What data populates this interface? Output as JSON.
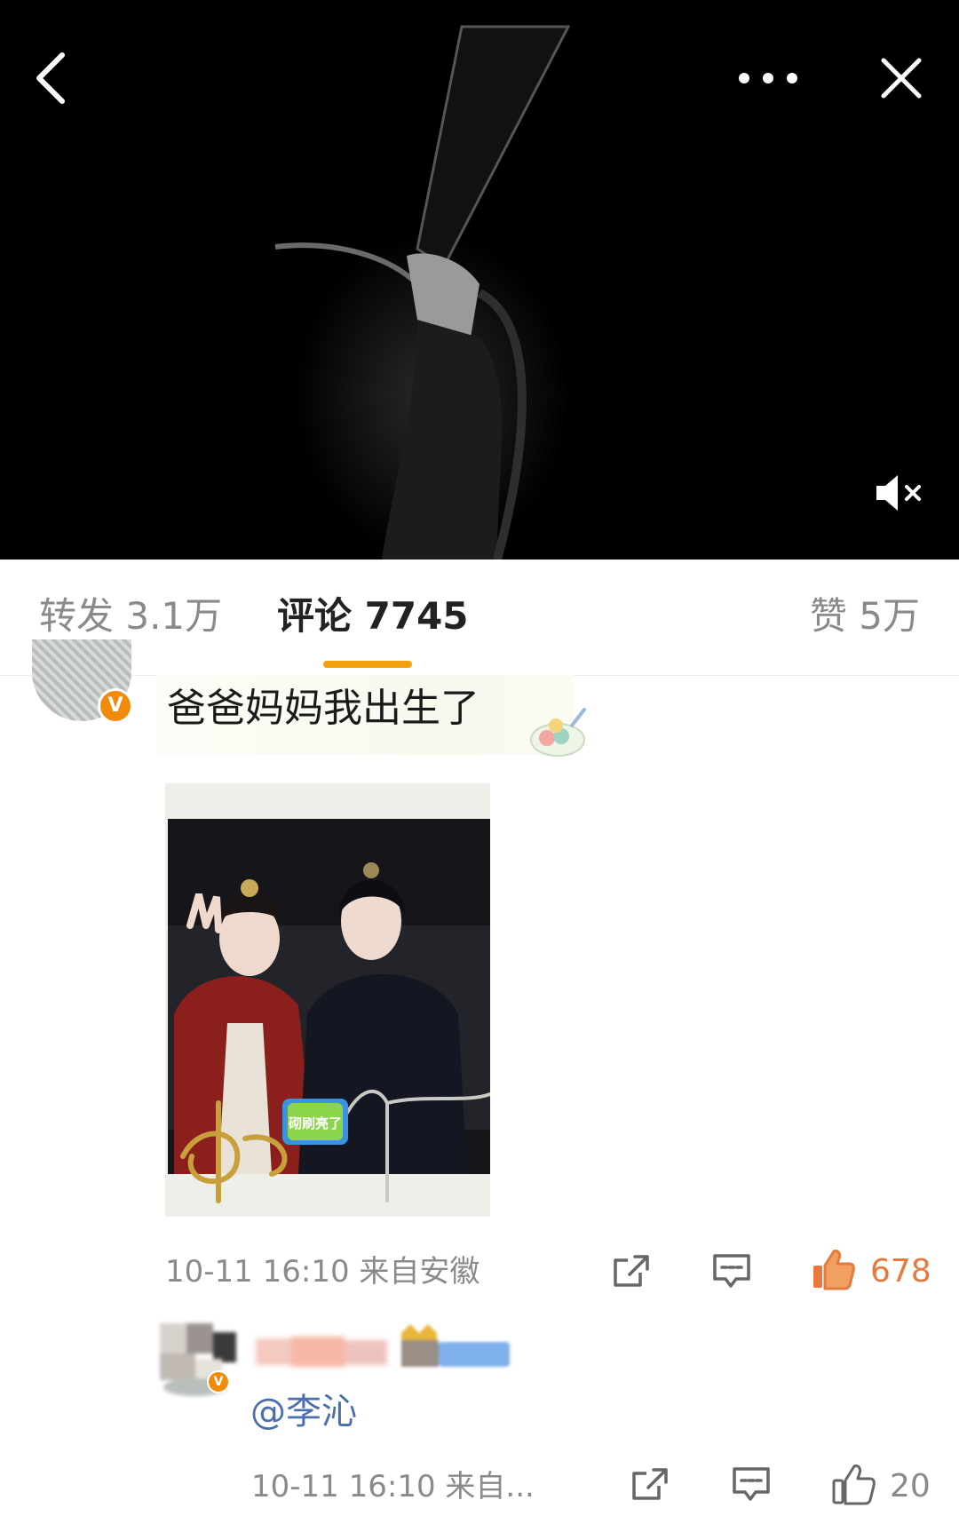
{
  "tabs": {
    "repost": "转发 3.1万",
    "comments": "评论 7745",
    "likes": "赞 5万"
  },
  "comment": {
    "text": "爸爸妈妈我出生了",
    "verified_badge": "V",
    "photo_sticker": "砌刷亮了",
    "meta": "10-11 16:10  来自安徽",
    "like_count": "678"
  },
  "reply": {
    "text": "@李沁",
    "verified_badge": "V",
    "meta": "10-11 16:10  来自...",
    "like_count": "20"
  },
  "icons": {
    "back": "chevron-left-icon",
    "more": "more-dots-icon",
    "close": "close-icon",
    "mute": "mute-icon",
    "share": "share-icon",
    "reply": "comment-icon",
    "like_active": "thumbs-up-filled-icon",
    "like": "thumbs-up-icon"
  },
  "colors": {
    "accent": "#f2a20f",
    "liked": "#e8793d",
    "verified": "#f28a0c",
    "mention": "#4a6fae"
  }
}
